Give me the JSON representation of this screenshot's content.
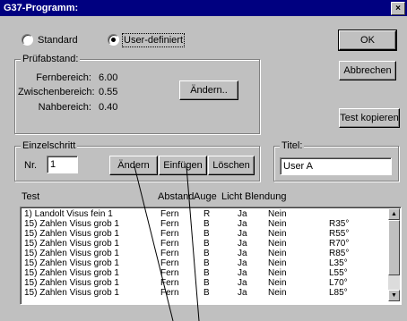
{
  "window": {
    "title": "G37-Programm:",
    "close_glyph": "×"
  },
  "mode": {
    "standard_label": "Standard",
    "user_label": "User-definiert",
    "selected": "user"
  },
  "buttons": {
    "ok": "OK",
    "abbrechen": "Abbrechen",
    "test_kopieren": "Test kopieren"
  },
  "pruefabstand": {
    "legend": "Prüfabstand:",
    "fern_label": "Fernbereich:",
    "fern_value": "6.00",
    "zwischen_label": "Zwischenbereich:",
    "zwischen_value": "0.55",
    "nah_label": "Nahbereich:",
    "nah_value": "0.40",
    "aendern": "Ändern.."
  },
  "einzelschritt": {
    "legend": "Einzelschritt",
    "nr_label": "Nr.",
    "nr_value": "1",
    "aendern": "Ändern",
    "einfuegen": "Einfügen",
    "loeschen": "Löschen"
  },
  "titel": {
    "legend": "Titel:",
    "value": "User A"
  },
  "table": {
    "headers": {
      "test": "Test",
      "abstand": "Abstand",
      "auge": "Auge",
      "licht": "Licht",
      "blendung": "Blendung"
    },
    "rows": [
      {
        "test": "1) Landolt Visus fein 1",
        "abstand": "Fern",
        "auge": "R",
        "licht": "Ja",
        "blendung": "Nein",
        "extra": ""
      },
      {
        "test": "15) Zahlen Visus grob 1",
        "abstand": "Fern",
        "auge": "B",
        "licht": "Ja",
        "blendung": "Nein",
        "extra": "R35°"
      },
      {
        "test": "15) Zahlen Visus grob 1",
        "abstand": "Fern",
        "auge": "B",
        "licht": "Ja",
        "blendung": "Nein",
        "extra": "R55°"
      },
      {
        "test": "15) Zahlen Visus grob 1",
        "abstand": "Fern",
        "auge": "B",
        "licht": "Ja",
        "blendung": "Nein",
        "extra": "R70°"
      },
      {
        "test": "15) Zahlen Visus grob 1",
        "abstand": "Fern",
        "auge": "B",
        "licht": "Ja",
        "blendung": "Nein",
        "extra": "R85°"
      },
      {
        "test": "15) Zahlen Visus grob 1",
        "abstand": "Fern",
        "auge": "B",
        "licht": "Ja",
        "blendung": "Nein",
        "extra": "L35°"
      },
      {
        "test": "15) Zahlen Visus grob 1",
        "abstand": "Fern",
        "auge": "B",
        "licht": "Ja",
        "blendung": "Nein",
        "extra": "L55°"
      },
      {
        "test": "15) Zahlen Visus grob 1",
        "abstand": "Fern",
        "auge": "B",
        "licht": "Ja",
        "blendung": "Nein",
        "extra": "L70°"
      },
      {
        "test": "15) Zahlen Visus grob 1",
        "abstand": "Fern",
        "auge": "B",
        "licht": "Ja",
        "blendung": "Nein",
        "extra": "L85°"
      }
    ]
  }
}
